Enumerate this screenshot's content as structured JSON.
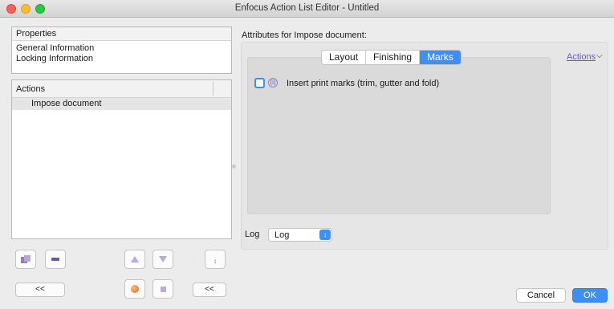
{
  "window": {
    "title": "Enfocus Action List Editor - Untitled"
  },
  "properties_panel": {
    "header": "Properties",
    "items": [
      "General Information",
      "Locking Information"
    ]
  },
  "actions_panel": {
    "header": "Actions",
    "items": [
      "Impose document"
    ]
  },
  "left_buttons": {
    "collapse_left": "<<",
    "collapse_right": "<<"
  },
  "attributes": {
    "label": "Attributes for Impose document:",
    "tabs": [
      "Layout",
      "Finishing",
      "Marks"
    ],
    "active_tab": "Marks",
    "actions_menu": "Actions",
    "checkbox_label": "Insert print marks (trim, gutter and fold)",
    "checkbox_checked": false,
    "info_glyph": "(i)"
  },
  "log": {
    "label": "Log",
    "value": "Log"
  },
  "dialog_buttons": {
    "cancel": "Cancel",
    "ok": "OK"
  },
  "colors": {
    "accent": "#3d8ff7",
    "link": "#6b58c4"
  }
}
